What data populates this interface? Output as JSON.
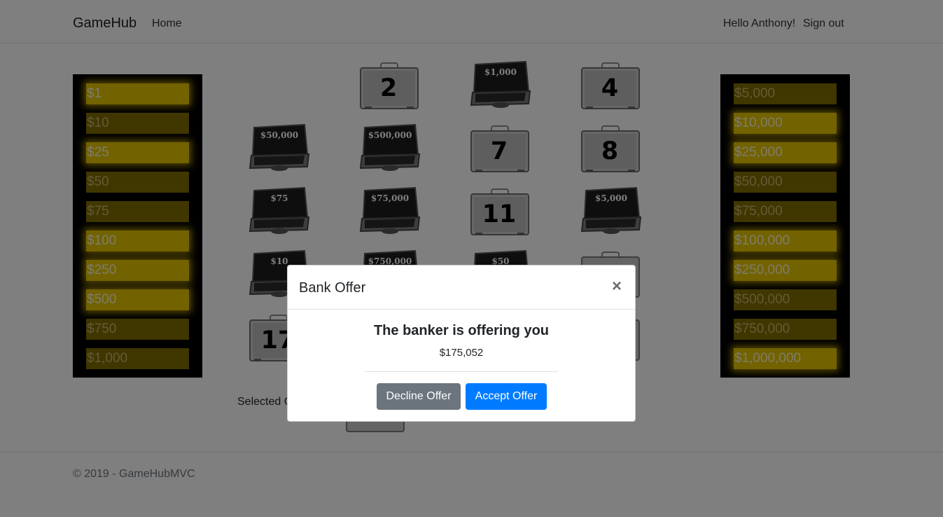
{
  "navbar": {
    "brand": "GameHub",
    "home": "Home",
    "hello": "Hello Anthony!",
    "signout": "Sign out"
  },
  "left_board": [
    {
      "label": "$1",
      "active": true
    },
    {
      "label": "$10",
      "active": false
    },
    {
      "label": "$25",
      "active": true
    },
    {
      "label": "$50",
      "active": false
    },
    {
      "label": "$75",
      "active": false
    },
    {
      "label": "$100",
      "active": true
    },
    {
      "label": "$250",
      "active": true
    },
    {
      "label": "$500",
      "active": true
    },
    {
      "label": "$750",
      "active": false
    },
    {
      "label": "$1,000",
      "active": false
    }
  ],
  "right_board": [
    {
      "label": "$5,000",
      "active": false
    },
    {
      "label": "$10,000",
      "active": true
    },
    {
      "label": "$25,000",
      "active": true
    },
    {
      "label": "$50,000",
      "active": false
    },
    {
      "label": "$75,000",
      "active": false
    },
    {
      "label": "$100,000",
      "active": true
    },
    {
      "label": "$250,000",
      "active": true
    },
    {
      "label": "$500,000",
      "active": false
    },
    {
      "label": "$750,000",
      "active": false
    },
    {
      "label": "$1,000,000",
      "active": true
    }
  ],
  "cases": [
    {
      "id": "c2",
      "state": "closed",
      "text": "2"
    },
    {
      "id": "c3",
      "state": "open",
      "text": "$1,000"
    },
    {
      "id": "c4",
      "state": "closed",
      "text": "4"
    },
    {
      "id": "c5",
      "state": "open",
      "text": "$50,000"
    },
    {
      "id": "c6",
      "state": "open",
      "text": "$500,000"
    },
    {
      "id": "c7",
      "state": "closed",
      "text": "7"
    },
    {
      "id": "c8",
      "state": "closed",
      "text": "8"
    },
    {
      "id": "c9",
      "state": "open",
      "text": "$75"
    },
    {
      "id": "c10",
      "state": "open",
      "text": "$75,000"
    },
    {
      "id": "c11",
      "state": "closed",
      "text": "11"
    },
    {
      "id": "c12",
      "state": "open",
      "text": "$5,000"
    },
    {
      "id": "c13",
      "state": "open",
      "text": "$10"
    },
    {
      "id": "c14",
      "state": "open",
      "text": "$750,000"
    },
    {
      "id": "c15",
      "state": "open",
      "text": "$50"
    },
    {
      "id": "c17",
      "state": "closed",
      "text": "17"
    }
  ],
  "selected_label": "Selected C",
  "footer": "© 2019 - GameHubMVC",
  "modal": {
    "title": "Bank Offer",
    "close": "×",
    "heading": "The banker is offering you",
    "offer": "$175,052",
    "decline": "Decline Offer",
    "accept": "Accept Offer"
  },
  "colors": {
    "accept": "#007bff",
    "decline": "#6c757d",
    "gold_active": "#e5c400",
    "gold_inactive": "#806d00"
  }
}
